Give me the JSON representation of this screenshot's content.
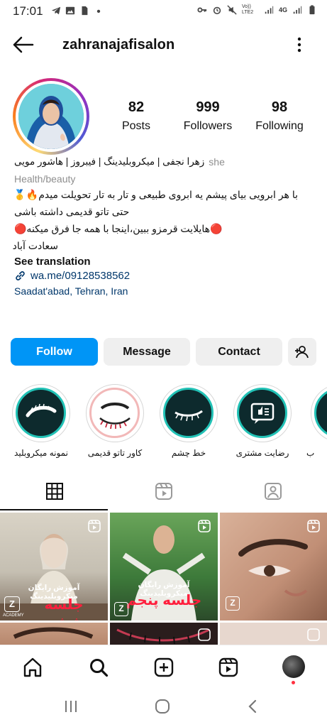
{
  "status_bar": {
    "time": "17:01",
    "network": "4G",
    "carrier": "Vo)) LTE2"
  },
  "header": {
    "username": "zahranajafisalon"
  },
  "stats": [
    {
      "value": "82",
      "label": "Posts"
    },
    {
      "value": "999",
      "label": "Followers"
    },
    {
      "value": "98",
      "label": "Following"
    }
  ],
  "bio": {
    "name": "زهرا نجفی | میکروبلیدینگ | فیبروز | هاشور مویی",
    "pronoun": "she",
    "category": "Health/beauty",
    "line1": "با هر ابرویی بیای پیشم یه ابروی طبیعی و تار به تار تحویلت میدم🔥🥇",
    "line2": "حتی تاتو قدیمی داشته باشی",
    "line3": "🔴هایلایت قرمزو ببین،اینجا با همه جا فرق میکنه🔴",
    "line4": "سعادت آباد",
    "see_translation": "See translation",
    "link": "wa.me/09128538562",
    "location": "Saadat'abad, Tehran, Iran"
  },
  "actions": {
    "follow": "Follow",
    "message": "Message",
    "contact": "Contact"
  },
  "highlights": [
    {
      "label": "نمونه میکروبلید"
    },
    {
      "label": "کاور تاتو قدیمی"
    },
    {
      "label": "خط چشم"
    },
    {
      "label": "رضایت مشتری"
    },
    {
      "label": "ب"
    }
  ],
  "posts": [
    {
      "caption": "آموزش رایگان میکروبلیدینگ",
      "session": "جلسه ششم",
      "brand": "ACADEMY"
    },
    {
      "caption": "آموزش رایگان میکروبلیدینگ",
      "session": "جلسه پنجم",
      "brand": "ACADEMY"
    }
  ],
  "colors": {
    "follow_blue": "#0095f6",
    "link_navy": "#00376b",
    "highlight_teal": "#22c2b6"
  }
}
